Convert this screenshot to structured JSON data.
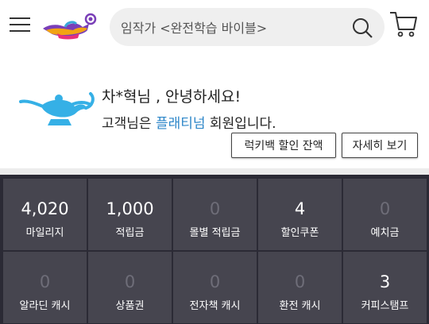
{
  "search": {
    "placeholder": "임작가 <완전학습 바이블>"
  },
  "greeting": {
    "title": "차*혁님 , 안녕하세요!",
    "prefix": "고객님은 ",
    "grade": "플래티넘",
    "suffix": " 회원입니다."
  },
  "buttons": {
    "balance": "럭키백 할인 잔액",
    "detail": "자세히 보기"
  },
  "stats": [
    {
      "value": "4,020",
      "label": "마일리지"
    },
    {
      "value": "1,000",
      "label": "적립금"
    },
    {
      "value": "0",
      "label": "몰별 적립금"
    },
    {
      "value": "4",
      "label": "할인쿠폰"
    },
    {
      "value": "0",
      "label": "예치금"
    },
    {
      "value": "0",
      "label": "알라딘 캐시"
    },
    {
      "value": "0",
      "label": "상품권"
    },
    {
      "value": "0",
      "label": "전자책 캐시"
    },
    {
      "value": "0",
      "label": "환전 캐시"
    },
    {
      "value": "3",
      "label": "커피스탬프"
    }
  ],
  "colors": {
    "accent_blue": "#2c86c8",
    "grid_bg": "#46454f",
    "dim_value": "#6e6d78"
  },
  "icons": [
    "menu-icon",
    "aladdin-lamp-logo",
    "search-icon",
    "cart-icon",
    "genie-lamp-icon"
  ]
}
